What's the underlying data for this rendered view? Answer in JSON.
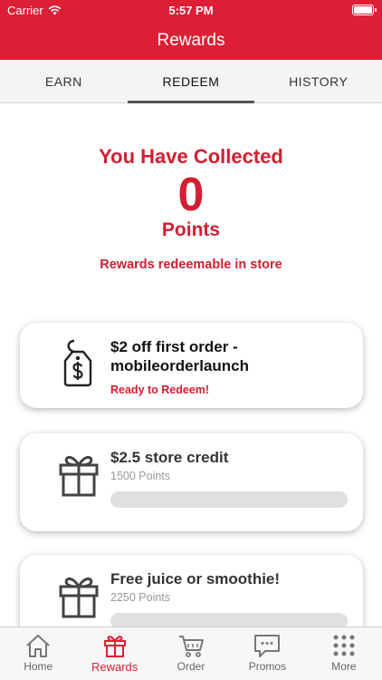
{
  "status_bar": {
    "carrier": "Carrier",
    "time": "5:57 PM"
  },
  "nav": {
    "title": "Rewards"
  },
  "tabs": [
    {
      "label": "EARN"
    },
    {
      "label": "REDEEM"
    },
    {
      "label": "HISTORY"
    }
  ],
  "points": {
    "heading": "You Have Collected",
    "value": "0",
    "unit": "Points",
    "note": "Rewards redeemable in store"
  },
  "rewards": [
    {
      "title": "$2 off first order - mobileorderlaunch",
      "status": "Ready to Redeem!",
      "icon": "price-tag-icon"
    },
    {
      "title": "$2.5 store credit",
      "points": "1500 Points",
      "progress": 0,
      "icon": "gift-icon"
    },
    {
      "title": "Free juice or smoothie!",
      "points": "2250 Points",
      "progress": 0,
      "icon": "gift-icon"
    }
  ],
  "bottom_tabs": [
    {
      "label": "Home",
      "icon": "home-icon"
    },
    {
      "label": "Rewards",
      "icon": "gift-icon"
    },
    {
      "label": "Order",
      "icon": "cart-icon"
    },
    {
      "label": "Promos",
      "icon": "chat-bubble-icon"
    },
    {
      "label": "More",
      "icon": "grid-dots-icon"
    }
  ],
  "colors": {
    "brand": "#dd1f35",
    "text_accent": "#d21f32"
  }
}
